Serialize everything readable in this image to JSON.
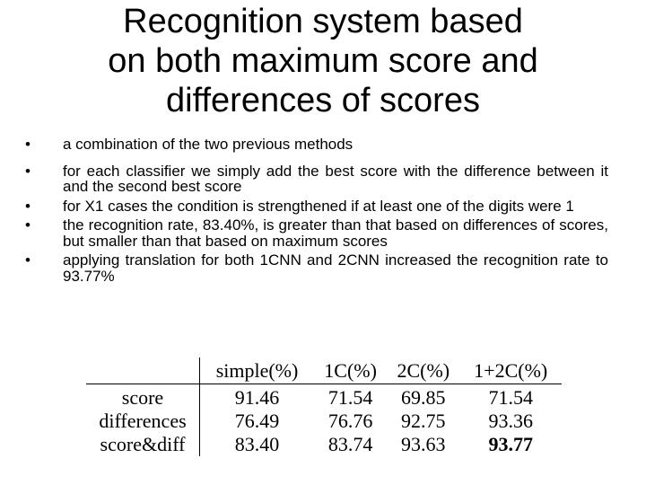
{
  "slide": {
    "title_lines": [
      "Recognition system based",
      "on both maximum score and",
      "differences of scores"
    ],
    "bullet_glyph": "•",
    "bullets": [
      "a combination of the two previous methods",
      "for each classifier we simply add the best score with the difference between it and the second best score",
      "for X1 cases the condition is strengthened if at least one of the digits were 1",
      "the recognition rate, 83.40%, is greater than that based on differences of scores, but smaller than that based on maximum scores",
      "applying translation for both 1CNN and 2CNN increased the recognition rate to 93.77%"
    ]
  },
  "table": {
    "corner": "",
    "columns": [
      "simple(%)",
      "1C(%)",
      "2C(%)",
      "1+2C(%)"
    ],
    "rows": [
      {
        "label": "score",
        "values": [
          "91.46",
          "71.54",
          "69.85",
          "71.54"
        ]
      },
      {
        "label": "differences",
        "values": [
          "76.49",
          "76.76",
          "92.75",
          "93.36"
        ]
      },
      {
        "label": "score&diff",
        "values": [
          "83.40",
          "83.74",
          "93.63",
          "93.77"
        ]
      }
    ],
    "highlight": {
      "row": 2,
      "col": 3
    }
  }
}
